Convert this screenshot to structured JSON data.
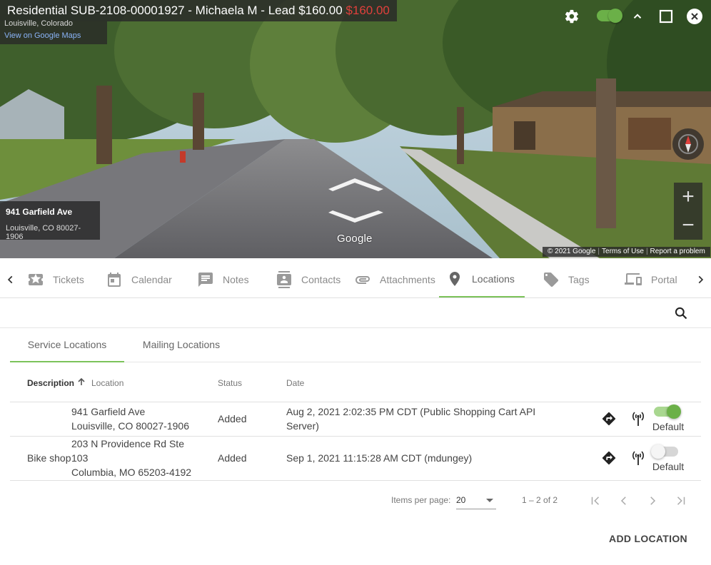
{
  "header": {
    "title_main": "Residential  SUB-2108-00001927 - Michaela M - Lead $160.00",
    "title_amount_red": "$160.00",
    "place_subtitle": "Louisville, Colorado",
    "google_maps_link": "View on Google Maps"
  },
  "streetview": {
    "address_card_title": "941 Garfield Ave",
    "address_card_subtitle": "Louisville, CO 80027-1906",
    "google_logo": "Google",
    "attribution": [
      "© 2021 Google",
      "Terms of Use",
      "Report a problem"
    ],
    "zoom_in": "+",
    "zoom_out": "−"
  },
  "tabs": [
    {
      "label": "Tickets",
      "icon": "star-ticket-icon"
    },
    {
      "label": "Calendar",
      "icon": "calendar-icon"
    },
    {
      "label": "Notes",
      "icon": "comment-icon"
    },
    {
      "label": "Contacts",
      "icon": "contact-card-icon"
    },
    {
      "label": "Attachments",
      "icon": "paperclip-icon"
    },
    {
      "label": "Locations",
      "icon": "map-pin-icon",
      "active": true
    },
    {
      "label": "Tags",
      "icon": "tag-icon"
    },
    {
      "label": "Portal",
      "icon": "devices-icon"
    }
  ],
  "subtabs": {
    "service": "Service Locations",
    "mailing": "Mailing Locations"
  },
  "table": {
    "headers": {
      "description": "Description",
      "location": "Location",
      "status": "Status",
      "date": "Date"
    },
    "rows": [
      {
        "description": "",
        "location_line1": "941 Garfield Ave",
        "location_line2": "Louisville, CO 80027-1906",
        "location_line3": "",
        "status": "Added",
        "date": "Aug 2, 2021 2:02:35 PM CDT (Public Shopping Cart API Server)",
        "default_on": true,
        "default_label": "Default"
      },
      {
        "description": "Bike shop",
        "location_line1": "203 N Providence Rd Ste",
        "location_line2": "103",
        "location_line3": "Columbia, MO 65203-4192",
        "status": "Added",
        "date": "Sep 1, 2021 11:15:28 AM CDT (mdungey)",
        "default_on": false,
        "default_label": "Default"
      }
    ]
  },
  "paginator": {
    "items_per_page_label": "Items per page:",
    "items_per_page_value": "20",
    "range_label": "1 – 2 of 2"
  },
  "actions": {
    "add_location": "ADD LOCATION"
  },
  "colors": {
    "accent_green": "#6bb048",
    "title_red": "#e0403c"
  }
}
